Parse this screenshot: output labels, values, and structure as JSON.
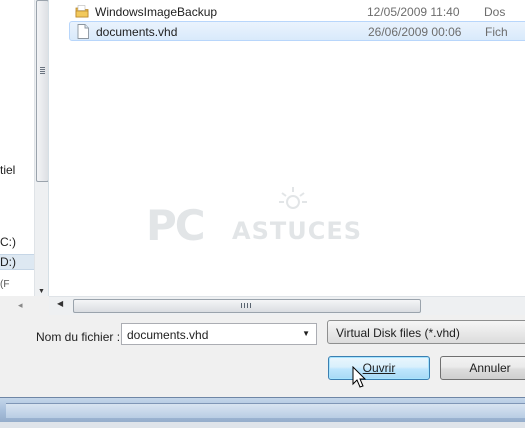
{
  "navigation": {
    "items": [
      {
        "label": "tiel"
      },
      {
        "label": "C:)"
      },
      {
        "label": "D:)"
      },
      {
        "label": "(F"
      }
    ]
  },
  "files": [
    {
      "name": "WindowsImageBackup",
      "date": "12/05/2009 11:40",
      "type": "Dos",
      "icon": "folder-icon",
      "selected": false
    },
    {
      "name": "documents.vhd",
      "date": "26/06/2009 00:06",
      "type": "Fich",
      "icon": "file-icon",
      "selected": true
    }
  ],
  "watermark": {
    "brand_left": "PC",
    "brand_right": "ASTUCES"
  },
  "footer": {
    "filename_label": "Nom du fichier :",
    "filename_value": "documents.vhd",
    "filetype_value": "Virtual Disk files (*.vhd)",
    "open_button": "Ouvrir",
    "cancel_button": "Annuler"
  },
  "colors": {
    "selection_bg": "#d9eafb",
    "selection_border": "#b8d6fb",
    "folder": "#e8b84a",
    "date_text": "#6d6d6d"
  }
}
